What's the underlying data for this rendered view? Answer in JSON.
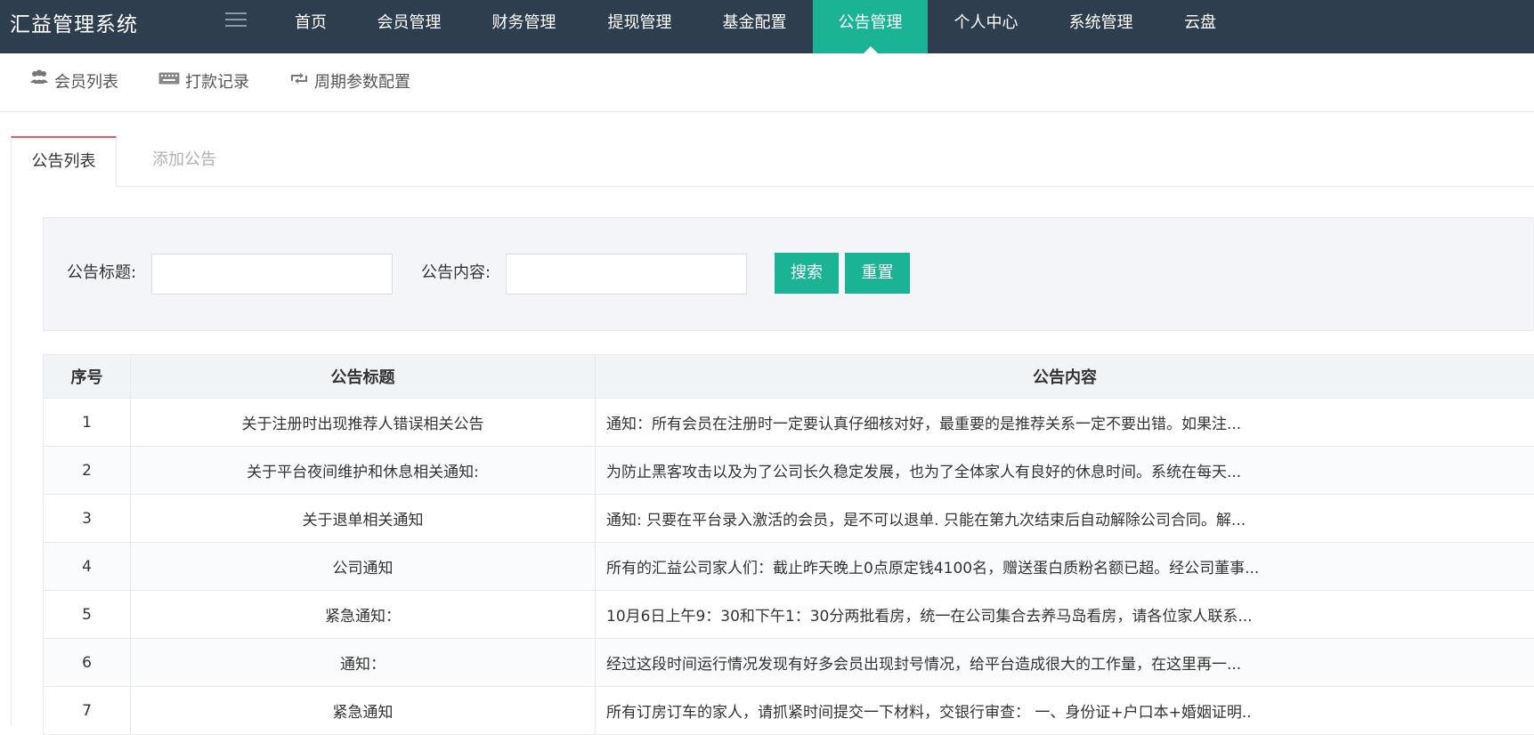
{
  "app": {
    "title": "汇益管理系统"
  },
  "top_nav": {
    "items": [
      {
        "label": "首页"
      },
      {
        "label": "会员管理"
      },
      {
        "label": "财务管理"
      },
      {
        "label": "提现管理"
      },
      {
        "label": "基金配置"
      },
      {
        "label": "公告管理",
        "active": true
      },
      {
        "label": "个人中心"
      },
      {
        "label": "系统管理"
      },
      {
        "label": "云盘"
      }
    ]
  },
  "sub_nav": {
    "items": [
      {
        "label": "会员列表",
        "icon": "users-icon"
      },
      {
        "label": "打款记录",
        "icon": "keyboard-icon"
      },
      {
        "label": "周期参数配置",
        "icon": "retweet-icon"
      }
    ]
  },
  "tabs": {
    "list": "公告列表",
    "add": "添加公告"
  },
  "search": {
    "title_label": "公告标题:",
    "title_value": "",
    "content_label": "公告内容:",
    "content_value": "",
    "search_button": "搜索",
    "reset_button": "重置"
  },
  "table": {
    "headers": {
      "index": "序号",
      "title": "公告标题",
      "content": "公告内容"
    },
    "rows": [
      {
        "index": "1",
        "title": "关于注册时出现推荐人错误相关公告",
        "content": "通知：所有会员在注册时一定要认真仔细核对好，最重要的是推荐关系一定不要出错。如果注..."
      },
      {
        "index": "2",
        "title": "关于平台夜间维护和休息相关通知:",
        "content": "为防止黑客攻击以及为了公司长久稳定发展，也为了全体家人有良好的休息时间。系统在每天..."
      },
      {
        "index": "3",
        "title": "关于退单相关通知",
        "content": "通知: 只要在平台录入激活的会员，是不可以退单. 只能在第九次结束后自动解除公司合同。解..."
      },
      {
        "index": "4",
        "title": "公司通知",
        "content": "所有的汇益公司家人们：截止昨天晚上0点原定钱4100名，赠送蛋白质粉名额已超。经公司董事..."
      },
      {
        "index": "5",
        "title": "紧急通知：",
        "content": "10月6日上午9：30和下午1：30分两批看房，统一在公司集合去养马岛看房，请各位家人联系..."
      },
      {
        "index": "6",
        "title": "通知：",
        "content": "经过这段时间运行情况发现有好多会员出现封号情况，给平台造成很大的工作量，在这里再一..."
      },
      {
        "index": "7",
        "title": "紧急通知",
        "content": "所有订房订车的家人，请抓紧时间提交一下材料，交银行审查： 一、身份证+户口本+婚姻证明.."
      }
    ]
  },
  "colors": {
    "topbar": "#2f3e4e",
    "accent": "#1ab394",
    "tab_active_border": "#ed5565"
  }
}
